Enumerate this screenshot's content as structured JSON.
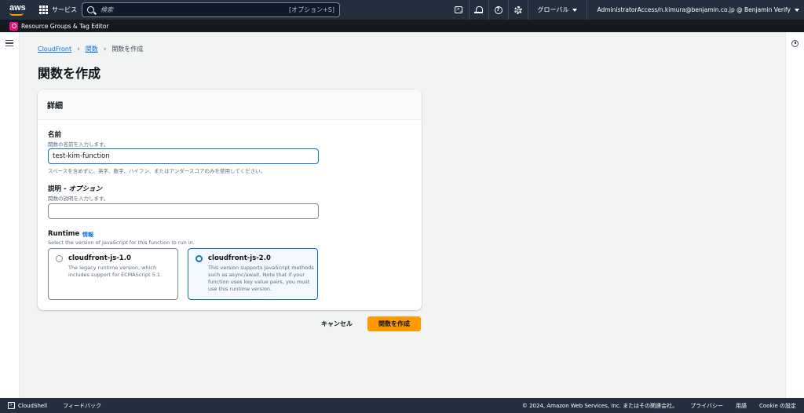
{
  "topnav": {
    "logo_text": "aws",
    "services_label": "サービス",
    "search_placeholder": "検索",
    "search_shortcut": "[オプション+S]",
    "terminal_glyph": ">_",
    "help_glyph": "?",
    "region_label": "グローバル",
    "account_label": "AdministratorAccess/n.kimura@benjamin.co.jp @ Benjamin Verify"
  },
  "subnav": {
    "service_label": "Resource Groups & Tag Editor"
  },
  "breadcrumb": {
    "items": [
      "CloudFront",
      "関数"
    ],
    "current": "関数を作成"
  },
  "page_title": "関数を作成",
  "details": {
    "header": "詳細",
    "name": {
      "label": "名前",
      "description": "関数の名前を入力します。",
      "value": "test-kim-function",
      "constraint": "スペースを含めずに、英字、数字、ハイフン、またはアンダースコアのみを使用してください。"
    },
    "description": {
      "label": "説明 - ",
      "label_optional": "オプション",
      "description": "関数の説明を入力します。",
      "value": ""
    },
    "runtime": {
      "label": "Runtime",
      "info_link": "情報",
      "description": "Select the version of JavaScript for this function to run in.",
      "options": [
        {
          "title": "cloudfront-js-1.0",
          "desc": "The legacy runtime version, which includes support for ECMAScript 5.1.",
          "selected": false
        },
        {
          "title": "cloudfront-js-2.0",
          "desc": "This version supports JavaScript methods such as async/await. Note that if your function uses key value pairs, you must use this runtime version.",
          "selected": true
        }
      ]
    }
  },
  "actions": {
    "cancel_label": "キャンセル",
    "create_label": "関数を作成"
  },
  "footer": {
    "cloudshell_glyph": ">_",
    "cloudshell_label": "CloudShell",
    "feedback_label": "フィードバック",
    "copyright": "© 2024, Amazon Web Services, Inc. またはその関連会社。",
    "privacy_label": "プライバシー",
    "terms_label": "用語",
    "cookie_label": "Cookie の設定"
  },
  "colors": {
    "nav_bg": "#232f3e",
    "primary_button": "#ff9900",
    "link": "#0972d3",
    "service_icon": "#e7157b"
  }
}
